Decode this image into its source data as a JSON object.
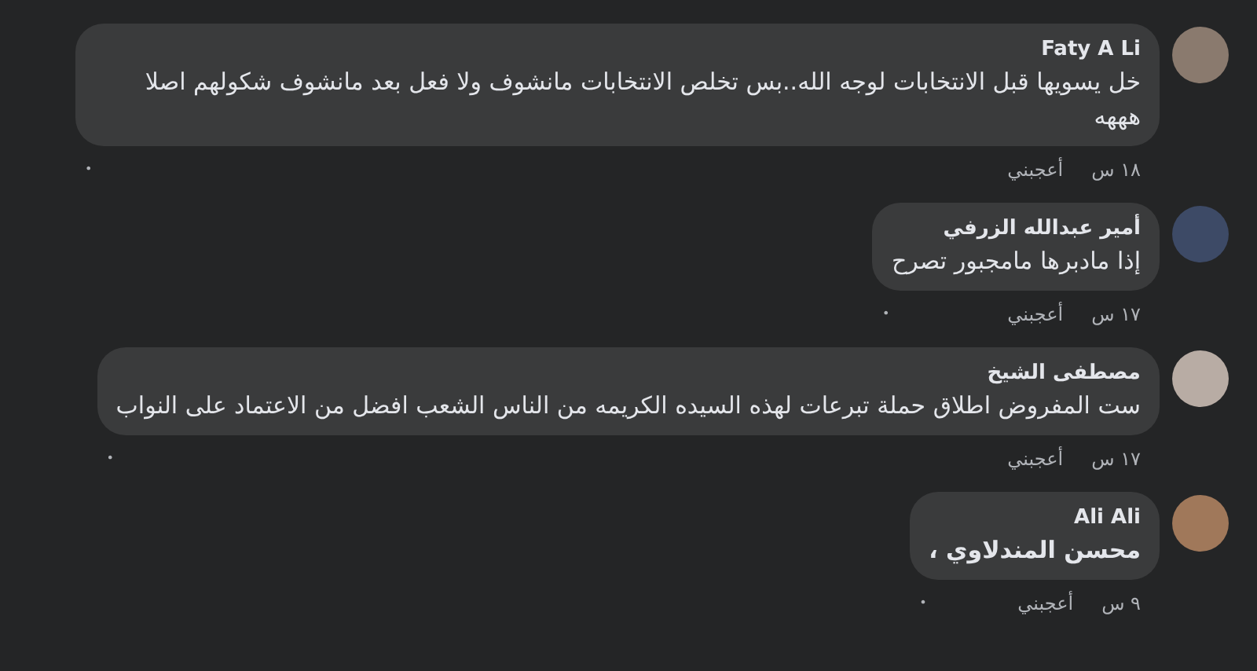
{
  "comments": [
    {
      "author": "Faty A Li",
      "text": "خل يسويها قبل الانتخابات لوجه الله..بس تخلص الانتخابات مانشوف ولا فعل بعد مانشوف شكولهم اصلا هههه",
      "emphasis": false,
      "time": "١٨ س",
      "like": "أعجبني",
      "dot": "•"
    },
    {
      "author": "أمير عبدالله الزرفي",
      "text": "إذا مادبرها مامجبور تصرح",
      "emphasis": false,
      "time": "١٧ س",
      "like": "أعجبني",
      "dot": "•"
    },
    {
      "author": "مصطفى الشيخ",
      "text": "ست المفروض اطلاق حملة تبرعات لهذه السيده الكريمه من الناس الشعب افضل من الاعتماد على النواب",
      "emphasis": false,
      "time": "١٧ س",
      "like": "أعجبني",
      "dot": "•"
    },
    {
      "author": "Ali Ali",
      "text": "محسن المندلاوي ،",
      "emphasis": true,
      "time": "٩ س",
      "like": "أعجبني",
      "dot": "•"
    }
  ]
}
